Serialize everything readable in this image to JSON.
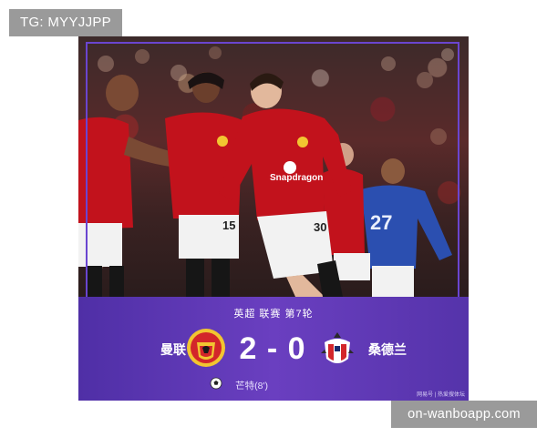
{
  "overlay": {
    "tg_label": "TG: MYYJJPP",
    "watermark": "on-wanboapp.com"
  },
  "match": {
    "league_round": "英超  联赛  第7轮",
    "home_team": "曼联",
    "away_team": "桑德兰",
    "score": "2 - 0",
    "scorer": "芒特(8')",
    "credit": "网易号 | 热爱搜体坛"
  },
  "photo": {
    "jersey_text": "Snapdragon",
    "jersey_numbers": [
      "15",
      "30",
      "27"
    ]
  },
  "colors": {
    "panel_purple": "#5d3bb0",
    "frame_purple": "#6a45d0",
    "united_red": "#c2121c",
    "sunderland_red": "#d3262a",
    "everton_blue": "#2b4fb0"
  },
  "icons": {
    "home_crest": "manchester-united-crest",
    "away_crest": "sunderland-crest",
    "goal": "football-icon"
  }
}
